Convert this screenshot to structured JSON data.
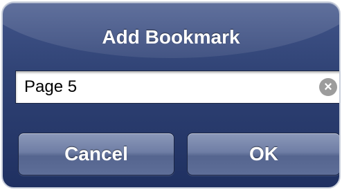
{
  "dialog": {
    "title": "Add Bookmark",
    "input": {
      "value": "Page 5"
    },
    "clear_icon": "clear-icon",
    "buttons": {
      "cancel_label": "Cancel",
      "ok_label": "OK"
    }
  },
  "colors": {
    "dialog_background": "#2f4274",
    "button_background": "#6f7ea5",
    "text": "#ffffff"
  }
}
